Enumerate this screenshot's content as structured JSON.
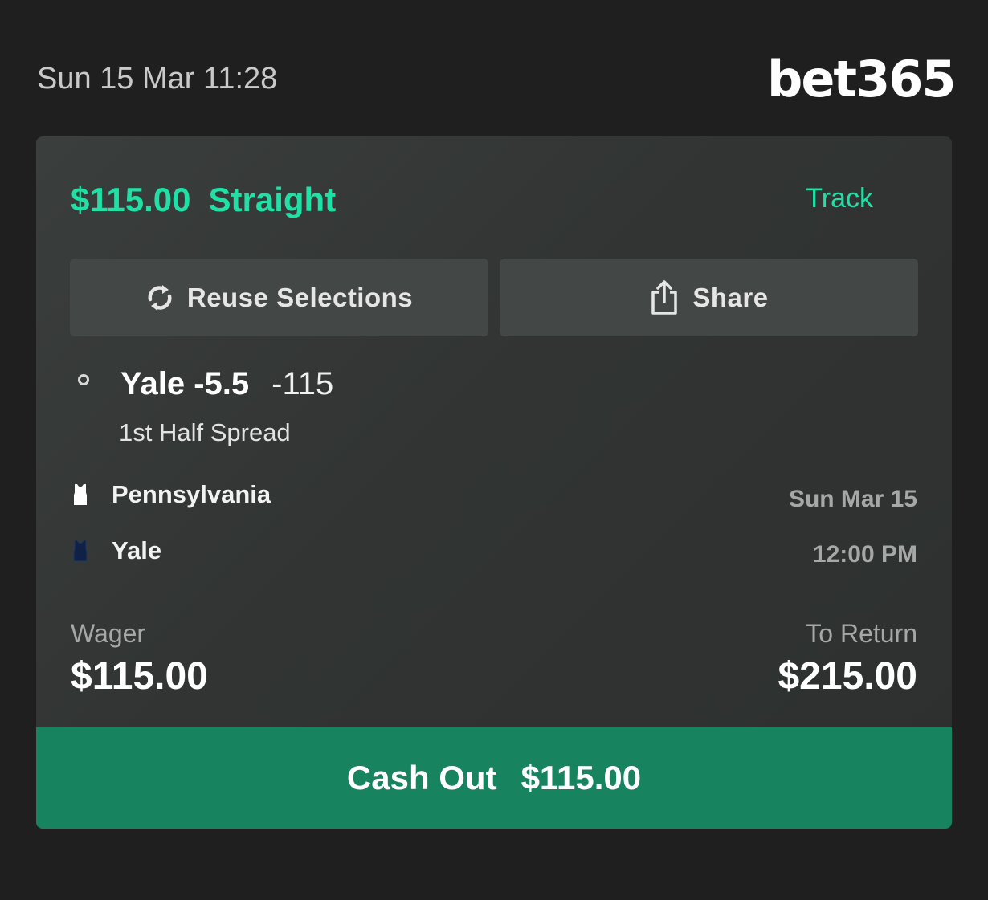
{
  "header": {
    "timestamp": "Sun 15 Mar 11:28",
    "brand": "bet365"
  },
  "bet": {
    "stake_label": "$115.00",
    "bet_type": "Straight",
    "track_label": "Track"
  },
  "actions": {
    "reuse_label": "Reuse Selections",
    "share_label": "Share"
  },
  "selection": {
    "name": "Yale -5.5",
    "odds": "-115",
    "market": "1st Half Spread"
  },
  "event": {
    "teams": [
      {
        "name": "Pennsylvania",
        "jersey_color": "#ffffff"
      },
      {
        "name": "Yale",
        "jersey_color": "#0f2147"
      }
    ],
    "date": "Sun Mar 15",
    "time": "12:00 PM"
  },
  "totals": {
    "wager_label": "Wager",
    "wager_amount": "$115.00",
    "return_label": "To Return",
    "return_amount": "$215.00"
  },
  "cashout": {
    "label": "Cash Out",
    "amount": "$115.00"
  },
  "colors": {
    "accent": "#20e0a5",
    "cashout_bg": "#18845f",
    "background": "#1f1f1f",
    "card": "#333635"
  }
}
